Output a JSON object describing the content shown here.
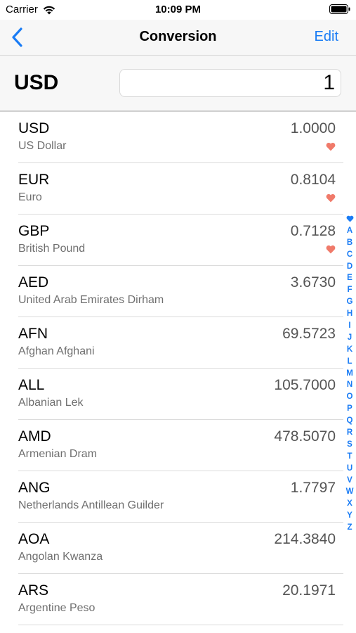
{
  "status_bar": {
    "carrier": "Carrier",
    "time": "10:09 PM"
  },
  "nav": {
    "title": "Conversion",
    "edit_label": "Edit",
    "back_icon": "chevron-left-icon"
  },
  "input": {
    "currency": "USD",
    "amount": "1"
  },
  "colors": {
    "accent": "#1a7cf5",
    "favorite": "#f07a6a"
  },
  "currencies": [
    {
      "code": "USD",
      "name": "US Dollar",
      "rate": "1.0000",
      "favorite": true
    },
    {
      "code": "EUR",
      "name": "Euro",
      "rate": "0.8104",
      "favorite": true
    },
    {
      "code": "GBP",
      "name": "British Pound",
      "rate": "0.7128",
      "favorite": true
    },
    {
      "code": "AED",
      "name": "United Arab Emirates Dirham",
      "rate": "3.6730",
      "favorite": false
    },
    {
      "code": "AFN",
      "name": "Afghan Afghani",
      "rate": "69.5723",
      "favorite": false
    },
    {
      "code": "ALL",
      "name": "Albanian Lek",
      "rate": "105.7000",
      "favorite": false
    },
    {
      "code": "AMD",
      "name": "Armenian Dram",
      "rate": "478.5070",
      "favorite": false
    },
    {
      "code": "ANG",
      "name": "Netherlands Antillean Guilder",
      "rate": "1.7797",
      "favorite": false
    },
    {
      "code": "AOA",
      "name": "Angolan Kwanza",
      "rate": "214.3840",
      "favorite": false
    },
    {
      "code": "ARS",
      "name": "Argentine Peso",
      "rate": "20.1971",
      "favorite": false
    }
  ],
  "index_letters": [
    "A",
    "B",
    "C",
    "D",
    "E",
    "F",
    "G",
    "H",
    "I",
    "J",
    "K",
    "L",
    "M",
    "N",
    "O",
    "P",
    "Q",
    "R",
    "S",
    "T",
    "U",
    "V",
    "W",
    "X",
    "Y",
    "Z"
  ]
}
